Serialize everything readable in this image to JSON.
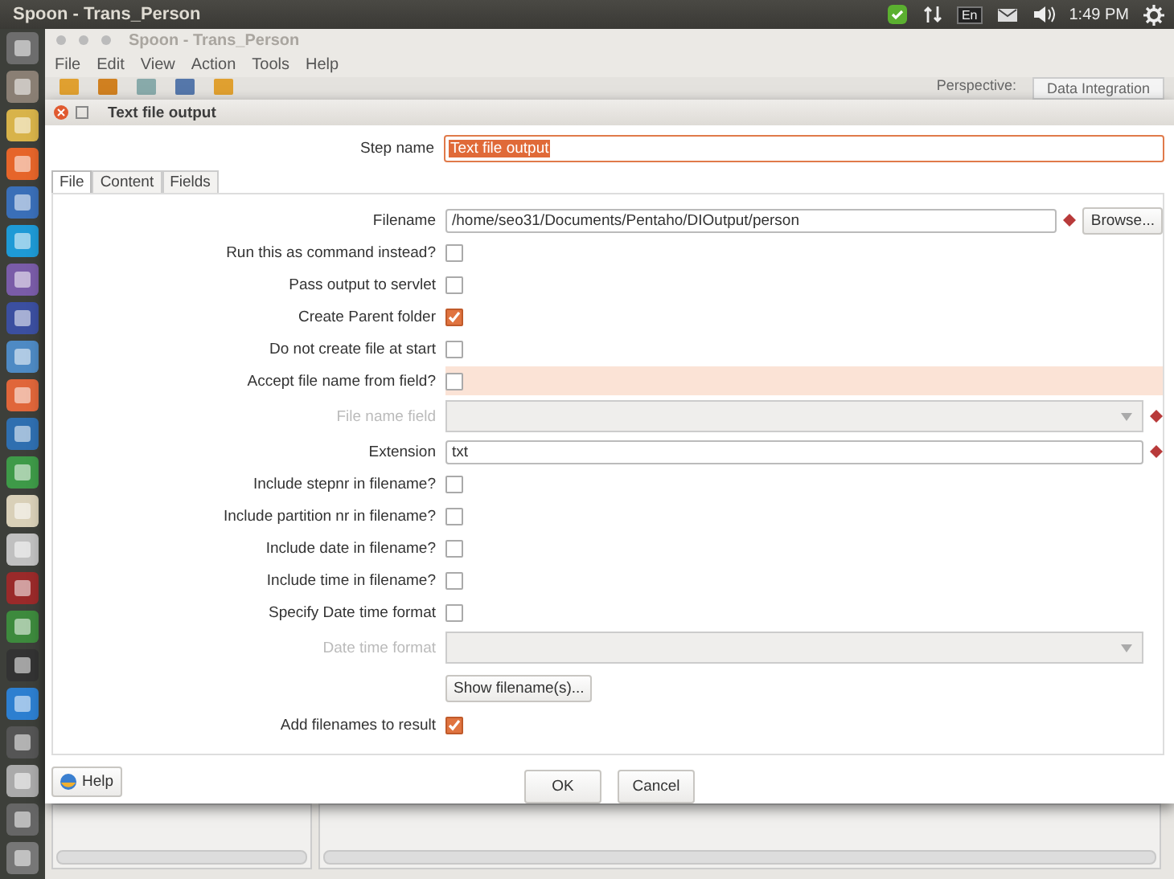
{
  "topbar": {
    "title": "Spoon - Trans_Person",
    "keyboard": "En",
    "time": "1:49 PM"
  },
  "app": {
    "title": "Spoon - Trans_Person",
    "menus": [
      "File",
      "Edit",
      "View",
      "Action",
      "Tools",
      "Help"
    ],
    "perspective_label": "Perspective:",
    "perspective": "Data Integration"
  },
  "dialog": {
    "title": "Text file output",
    "step_name_label": "Step name",
    "step_name": "Text file output",
    "tabs": [
      {
        "label": "File",
        "selected": true
      },
      {
        "label": "Content",
        "selected": false
      },
      {
        "label": "Fields",
        "selected": false
      }
    ],
    "rows": [
      {
        "kind": "text",
        "label": "Filename",
        "value": "/home/seo31/Documents/Pentaho/DIOutput/person",
        "required": true,
        "button": "Browse..."
      },
      {
        "kind": "checkbox",
        "label": "Run this as command instead?",
        "checked": false,
        "highlighted": false
      },
      {
        "kind": "checkbox",
        "label": "Pass output to servlet",
        "checked": false,
        "highlighted": false
      },
      {
        "kind": "checkbox",
        "label": "Create Parent folder",
        "checked": true,
        "highlighted": false
      },
      {
        "kind": "checkbox",
        "label": "Do not create file at start",
        "checked": false,
        "highlighted": false
      },
      {
        "kind": "checkbox",
        "label": "Accept file name from field?",
        "checked": false,
        "highlighted": true
      },
      {
        "kind": "combo",
        "label": "File name field",
        "required": true,
        "disabled": true
      },
      {
        "kind": "text",
        "label": "Extension",
        "value": "txt",
        "required": true
      },
      {
        "kind": "checkbox",
        "label": "Include stepnr in filename?",
        "checked": false,
        "highlighted": false
      },
      {
        "kind": "checkbox",
        "label": "Include partition nr in filename?",
        "checked": false,
        "highlighted": false
      },
      {
        "kind": "checkbox",
        "label": "Include date in filename?",
        "checked": false,
        "highlighted": false
      },
      {
        "kind": "checkbox",
        "label": "Include time in filename?",
        "checked": false,
        "highlighted": false
      },
      {
        "kind": "checkbox",
        "label": "Specify Date time format",
        "checked": false,
        "highlighted": false
      },
      {
        "kind": "combo",
        "label": "Date time format",
        "required": false,
        "disabled": true
      },
      {
        "kind": "button",
        "label": "Show filename(s)..."
      },
      {
        "kind": "checkbox",
        "label": "Add filenames to result",
        "checked": true,
        "highlighted": false
      }
    ],
    "buttons": [
      "OK",
      "Cancel"
    ],
    "help": "Help"
  }
}
